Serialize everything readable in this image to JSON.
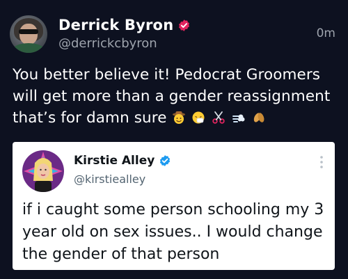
{
  "post": {
    "author": {
      "display_name": "Derrick Byron",
      "handle": "@derrickcbyron",
      "badge_icon": "verified-seal-icon",
      "badge_color": "#e0245e"
    },
    "timestamp": "0m",
    "text": "You better believe it! Pedocrat Groomers will get more than a gender reassignment that’s for damn sure",
    "emojis": [
      "cowboy-face-icon",
      "sneezing-face-icon",
      "scissors-icon",
      "dash-icon",
      "peanuts-icon"
    ]
  },
  "quoted": {
    "author": {
      "display_name": "Kirstie Alley",
      "handle": "@kirstiealley",
      "badge_icon": "verified-check-icon",
      "badge_color": "#1d9bf0"
    },
    "more_icon": "more-vertical-icon",
    "text": "if i caught some person schooling my 3 year old on sex issues.. I would change the gender of that person"
  },
  "colors": {
    "background": "#0d1120",
    "card": "#ffffff",
    "secondary_text": "#9ea4ad"
  }
}
